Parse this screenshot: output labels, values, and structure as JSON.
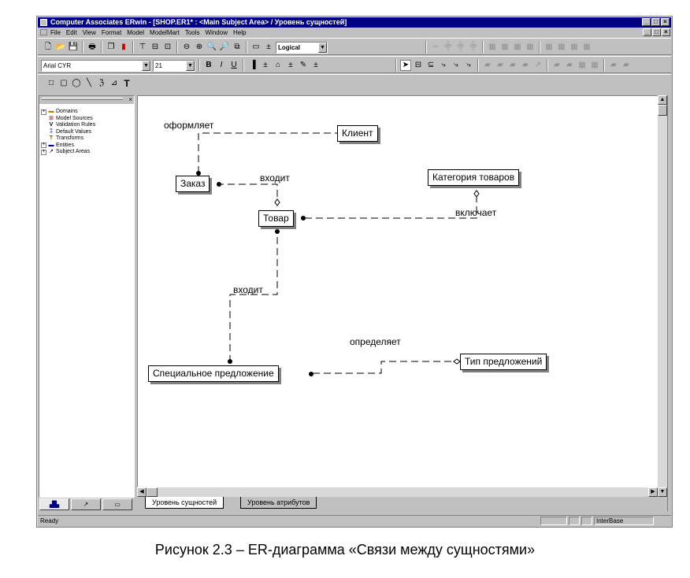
{
  "window": {
    "title": "Computer Associates ERwin - [SHOP.ER1* : <Main Subject Area> / Уровень сущностей]",
    "controls": [
      "_",
      "□",
      "×"
    ]
  },
  "menu": [
    "File",
    "Edit",
    "View",
    "Format",
    "Model",
    "ModelMart",
    "Tools",
    "Window",
    "Help"
  ],
  "toolbar": {
    "view_mode": "Logical",
    "font_name": "Arial CYR",
    "font_size": "21",
    "format_bold": "B",
    "format_italic": "I",
    "format_underline": "U",
    "text_tool": "T"
  },
  "model_explorer": {
    "items": [
      {
        "label": "Domains",
        "expandable": true
      },
      {
        "label": "Model Sources",
        "expandable": false
      },
      {
        "label": "Validation Rules",
        "expandable": false
      },
      {
        "label": "Default Values",
        "expandable": false
      },
      {
        "label": "Transforms",
        "expandable": false
      },
      {
        "label": "Entities",
        "expandable": true
      },
      {
        "label": "Subject Areas",
        "expandable": true
      }
    ]
  },
  "diagram": {
    "entities": {
      "client": "Клиент",
      "order": "Заказ",
      "category": "Категория товаров",
      "product": "Товар",
      "special_offer": "Специальное предложение",
      "offer_type": "Тип предложений"
    },
    "relationships": {
      "forms": "оформляет",
      "order_includes": "входит",
      "includes": "включает",
      "offer_includes": "входит",
      "defines": "определяет"
    }
  },
  "page_tabs": [
    "Уровень сущностей",
    "Уровень атрибутов"
  ],
  "status": {
    "left": "Ready",
    "database": "InterBase"
  },
  "caption": "Рисунок 2.3 – ER-диаграмма «Связи между сущностями»"
}
